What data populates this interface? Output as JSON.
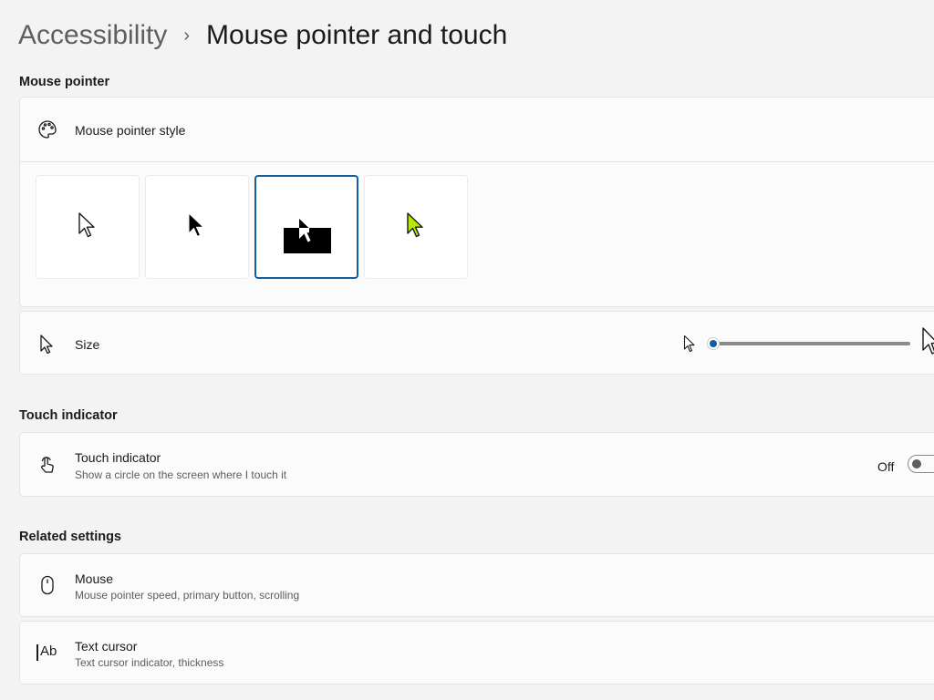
{
  "breadcrumb": {
    "parent": "Accessibility",
    "separator": "›",
    "current": "Mouse pointer and touch"
  },
  "sections": {
    "mouse_pointer": "Mouse pointer",
    "touch_indicator": "Touch indicator",
    "related_settings": "Related settings"
  },
  "pointer_style": {
    "title": "Mouse pointer style",
    "icon": "palette-icon",
    "options": [
      {
        "name": "white",
        "icon": "white-pointer-icon",
        "selected": false
      },
      {
        "name": "black",
        "icon": "black-pointer-icon",
        "selected": false
      },
      {
        "name": "inverted",
        "icon": "inverted-pointer-icon",
        "selected": true
      },
      {
        "name": "custom",
        "icon": "custom-pointer-icon",
        "selected": false,
        "color": "#b7e80a"
      }
    ]
  },
  "size": {
    "title": "Size",
    "icon": "pointer-icon",
    "value": 1
  },
  "touch": {
    "title": "Touch indicator",
    "subtitle": "Show a circle on the screen where I touch it",
    "icon": "touch-icon",
    "toggle_label": "Off",
    "enabled": false
  },
  "related": [
    {
      "title": "Mouse",
      "subtitle": "Mouse pointer speed, primary button, scrolling",
      "icon": "mouse-icon"
    },
    {
      "title": "Text cursor",
      "subtitle": "Text cursor indicator, thickness",
      "icon": "text-cursor-icon",
      "glyph": "Ab"
    }
  ],
  "colors": {
    "accent": "#115ea3",
    "background": "#f3f3f3",
    "card": "#fbfbfb"
  }
}
